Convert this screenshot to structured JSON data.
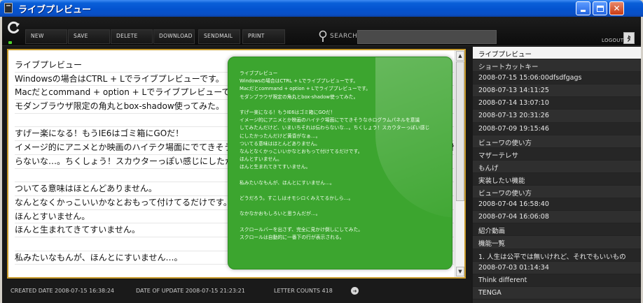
{
  "window": {
    "title": "ライブプレビュー"
  },
  "toolbar": {
    "buttons": [
      "NEW",
      "SAVE",
      "DELETE",
      "DOWNLOAD",
      "SENDMAIL",
      "PRINT"
    ],
    "search_label": "SEARCH",
    "search_value": "",
    "logout_label": "LOGOUT"
  },
  "editor": {
    "lines": [
      "ライブプレビュー",
      "Windowsの場合はCTRL + Lでライブプレビューです。",
      "Macだとcommand + option + Lでライブプレビューです。",
      "モダンブラウザ限定の角丸とbox-shadow使ってみた。",
      "",
      "すげー楽になる！もうIE6はゴミ箱にGOだ！",
      "イメージ的にアニメとか映画のハイテク場面にでてきそうなホログラムパネルを意識してみたんだけど、いまいちそれは伝わ",
      "らないな…。ちくしょう！スカウターっぽい感じにしたかったんだけど",
      "",
      "ついてる意味はほとんどありません。",
      "なんとなくかっこいいかなとおもって付けてるだけです。",
      "ほんとすいません。",
      "ほんと生まれてきてすいません。",
      "",
      "私みたいなもんが、ほんとにすいません…。"
    ]
  },
  "preview": {
    "lines": [
      "ライブプレビュー",
      "Windowsの場合はCTRL + Lでライブプレビューです。",
      "Macだとcommand + option + Lでライブプレビューです。",
      "モダンブラウザ限定の角丸とbox-shadow使ってみた。",
      "",
      "すげー楽になる！もうIE6はゴミ箱にGOだ！",
      "イメージ的にアニメとか映画のハイテク場面にでてきそうなホログラムパネルを意識",
      "してみたんだけど、いまいちそれは伝わらないな…。ちくしょう！スカウターっぽい感じ",
      "にしたかったんだけど黄昏がなぁ…。",
      "ついてる意味はほとんどありません。",
      "なんとなくかっこいいかなとおもって付けてるだけです。",
      "ほんとすいません。",
      "ほんと生まれてきてすいません。",
      "",
      "私みたいなもんが、ほんとにすいません…。",
      "",
      "どうだろう。すこしはオモシロくみえてるかしら…。",
      "",
      "なかなかおもしろいと思うんだが…。",
      "",
      "スクロールバーを出さず、完全に見かけ倒しにしてみた。",
      "スクロールは自動的に一番下の行が表示される。"
    ]
  },
  "status": {
    "created": "CREATED DATE 2008-07-15 16:38:24",
    "updated": "DATE OF UPDATE 2008-07-15 21:23:21",
    "count": "LETTER COUNTS 418"
  },
  "file_list": {
    "items": [
      "ライブプレビュー",
      "ショートカットキー",
      "2008-07-15 15:06:00dfsdfgags",
      "2008-07-13 14:11:25",
      "2008-07-14 13:07:10",
      "2008-07-13 20:31:26",
      "2008-07-09 19:15:46",
      "ビューワの使い方",
      "マザーテレサ",
      "もんげ",
      "実装したい機能",
      "ビューワの使い方",
      "2008-07-04 16:58:40",
      "2008-07-04 16:06:08",
      "紹介動画",
      "機能一覧",
      "1. 人生は公平では無いけれど、それでもいいもの",
      "2008-07-03 01:14:34",
      "Think different",
      "TENGA"
    ]
  }
}
